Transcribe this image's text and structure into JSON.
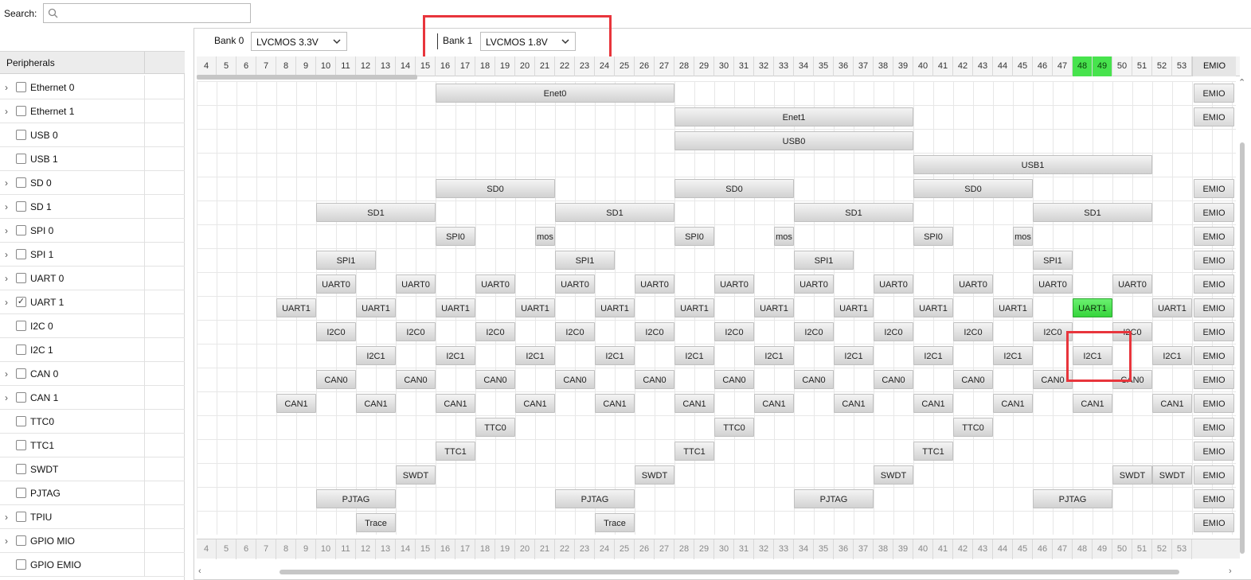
{
  "search": {
    "label": "Search:",
    "placeholder": ""
  },
  "peripherals": {
    "header": "Peripherals",
    "items": [
      {
        "label": "Ethernet 0",
        "expandable": true,
        "checked": false
      },
      {
        "label": "Ethernet 1",
        "expandable": true,
        "checked": false
      },
      {
        "label": "USB 0",
        "expandable": false,
        "checked": false
      },
      {
        "label": "USB 1",
        "expandable": false,
        "checked": false
      },
      {
        "label": "SD 0",
        "expandable": true,
        "checked": false
      },
      {
        "label": "SD 1",
        "expandable": true,
        "checked": false
      },
      {
        "label": "SPI 0",
        "expandable": true,
        "checked": false
      },
      {
        "label": "SPI 1",
        "expandable": true,
        "checked": false
      },
      {
        "label": "UART 0",
        "expandable": true,
        "checked": false
      },
      {
        "label": "UART 1",
        "expandable": true,
        "checked": true
      },
      {
        "label": "I2C 0",
        "expandable": false,
        "checked": false
      },
      {
        "label": "I2C 1",
        "expandable": false,
        "checked": false
      },
      {
        "label": "CAN 0",
        "expandable": true,
        "checked": false
      },
      {
        "label": "CAN 1",
        "expandable": true,
        "checked": false
      },
      {
        "label": "TTC0",
        "expandable": false,
        "checked": false
      },
      {
        "label": "TTC1",
        "expandable": false,
        "checked": false
      },
      {
        "label": "SWDT",
        "expandable": false,
        "checked": false
      },
      {
        "label": "PJTAG",
        "expandable": false,
        "checked": false
      },
      {
        "label": "TPIU",
        "expandable": true,
        "checked": false
      },
      {
        "label": "GPIO MIO",
        "expandable": true,
        "checked": false
      },
      {
        "label": "GPIO EMIO",
        "expandable": false,
        "checked": false
      }
    ]
  },
  "banks": {
    "bank0": {
      "label": "Bank 0",
      "value": "LVCMOS 3.3V"
    },
    "bank1": {
      "label": "Bank 1",
      "value": "LVCMOS 1.8V"
    }
  },
  "pins": {
    "numbers": [
      "4",
      "5",
      "6",
      "7",
      "8",
      "9",
      "10",
      "11",
      "12",
      "13",
      "14",
      "15",
      "16",
      "17",
      "18",
      "19",
      "20",
      "21",
      "22",
      "23",
      "24",
      "25",
      "26",
      "27",
      "28",
      "29",
      "30",
      "31",
      "32",
      "33",
      "34",
      "35",
      "36",
      "37",
      "38",
      "39",
      "40",
      "41",
      "42",
      "43",
      "44",
      "45",
      "46",
      "47",
      "48",
      "49",
      "50",
      "51",
      "52",
      "53"
    ],
    "active": [
      "48",
      "49"
    ],
    "emio_label": "EMIO"
  },
  "grid_rows": [
    {
      "emio": "EMIO",
      "blocks": [
        {
          "label": "Enet0",
          "from": "16",
          "to": "27"
        }
      ]
    },
    {
      "emio": "EMIO",
      "blocks": [
        {
          "label": "Enet1",
          "from": "28",
          "to": "39"
        }
      ]
    },
    {
      "emio": "",
      "blocks": [
        {
          "label": "USB0",
          "from": "28",
          "to": "39"
        }
      ]
    },
    {
      "emio": "",
      "blocks": [
        {
          "label": "USB1",
          "from": "40",
          "to": "51"
        }
      ]
    },
    {
      "emio": "EMIO",
      "blocks": [
        {
          "label": "SD0",
          "from": "16",
          "to": "21"
        },
        {
          "label": "SD0",
          "from": "28",
          "to": "33"
        },
        {
          "label": "SD0",
          "from": "40",
          "to": "45"
        }
      ]
    },
    {
      "emio": "EMIO",
      "blocks": [
        {
          "label": "SD1",
          "from": "10",
          "to": "15"
        },
        {
          "label": "SD1",
          "from": "22",
          "to": "27"
        },
        {
          "label": "SD1",
          "from": "34",
          "to": "39"
        },
        {
          "label": "SD1",
          "from": "46",
          "to": "51"
        }
      ]
    },
    {
      "emio": "EMIO",
      "blocks": [
        {
          "label": "SPI0",
          "from": "16",
          "to": "17"
        },
        {
          "label": "mos",
          "from": "21",
          "to": "21"
        },
        {
          "label": "SPI0",
          "from": "28",
          "to": "29"
        },
        {
          "label": "mos",
          "from": "33",
          "to": "33"
        },
        {
          "label": "SPI0",
          "from": "40",
          "to": "41"
        },
        {
          "label": "mos",
          "from": "45",
          "to": "45"
        }
      ]
    },
    {
      "emio": "EMIO",
      "blocks": [
        {
          "label": "SPI1",
          "from": "10",
          "to": "12"
        },
        {
          "label": "SPI1",
          "from": "22",
          "to": "24"
        },
        {
          "label": "SPI1",
          "from": "34",
          "to": "36"
        },
        {
          "label": "SPI1",
          "from": "46",
          "to": "47"
        }
      ]
    },
    {
      "emio": "EMIO",
      "blocks": [
        {
          "label": "UART0",
          "from": "10",
          "to": "11"
        },
        {
          "label": "UART0",
          "from": "14",
          "to": "15"
        },
        {
          "label": "UART0",
          "from": "18",
          "to": "19"
        },
        {
          "label": "UART0",
          "from": "22",
          "to": "23"
        },
        {
          "label": "UART0",
          "from": "26",
          "to": "27"
        },
        {
          "label": "UART0",
          "from": "30",
          "to": "31"
        },
        {
          "label": "UART0",
          "from": "34",
          "to": "35"
        },
        {
          "label": "UART0",
          "from": "38",
          "to": "39"
        },
        {
          "label": "UART0",
          "from": "42",
          "to": "43"
        },
        {
          "label": "UART0",
          "from": "46",
          "to": "47"
        },
        {
          "label": "UART0",
          "from": "50",
          "to": "51"
        }
      ]
    },
    {
      "emio": "EMIO",
      "blocks": [
        {
          "label": "UART1",
          "from": "8",
          "to": "9"
        },
        {
          "label": "UART1",
          "from": "12",
          "to": "13"
        },
        {
          "label": "UART1",
          "from": "16",
          "to": "17"
        },
        {
          "label": "UART1",
          "from": "20",
          "to": "21"
        },
        {
          "label": "UART1",
          "from": "24",
          "to": "25"
        },
        {
          "label": "UART1",
          "from": "28",
          "to": "29"
        },
        {
          "label": "UART1",
          "from": "32",
          "to": "33"
        },
        {
          "label": "UART1",
          "from": "36",
          "to": "37"
        },
        {
          "label": "UART1",
          "from": "40",
          "to": "41"
        },
        {
          "label": "UART1",
          "from": "44",
          "to": "45"
        },
        {
          "label": "UART1",
          "from": "48",
          "to": "49",
          "selected": true
        },
        {
          "label": "UART1",
          "from": "52",
          "to": "53"
        }
      ]
    },
    {
      "emio": "EMIO",
      "blocks": [
        {
          "label": "I2C0",
          "from": "10",
          "to": "11"
        },
        {
          "label": "I2C0",
          "from": "14",
          "to": "15"
        },
        {
          "label": "I2C0",
          "from": "18",
          "to": "19"
        },
        {
          "label": "I2C0",
          "from": "22",
          "to": "23"
        },
        {
          "label": "I2C0",
          "from": "26",
          "to": "27"
        },
        {
          "label": "I2C0",
          "from": "30",
          "to": "31"
        },
        {
          "label": "I2C0",
          "from": "34",
          "to": "35"
        },
        {
          "label": "I2C0",
          "from": "38",
          "to": "39"
        },
        {
          "label": "I2C0",
          "from": "42",
          "to": "43"
        },
        {
          "label": "I2C0",
          "from": "46",
          "to": "47"
        },
        {
          "label": "I2C0",
          "from": "50",
          "to": "51"
        }
      ]
    },
    {
      "emio": "EMIO",
      "blocks": [
        {
          "label": "I2C1",
          "from": "12",
          "to": "13"
        },
        {
          "label": "I2C1",
          "from": "16",
          "to": "17"
        },
        {
          "label": "I2C1",
          "from": "20",
          "to": "21"
        },
        {
          "label": "I2C1",
          "from": "24",
          "to": "25"
        },
        {
          "label": "I2C1",
          "from": "28",
          "to": "29"
        },
        {
          "label": "I2C1",
          "from": "32",
          "to": "33"
        },
        {
          "label": "I2C1",
          "from": "36",
          "to": "37"
        },
        {
          "label": "I2C1",
          "from": "40",
          "to": "41"
        },
        {
          "label": "I2C1",
          "from": "44",
          "to": "45"
        },
        {
          "label": "I2C1",
          "from": "48",
          "to": "49"
        },
        {
          "label": "I2C1",
          "from": "52",
          "to": "53"
        }
      ]
    },
    {
      "emio": "EMIO",
      "blocks": [
        {
          "label": "CAN0",
          "from": "10",
          "to": "11"
        },
        {
          "label": "CAN0",
          "from": "14",
          "to": "15"
        },
        {
          "label": "CAN0",
          "from": "18",
          "to": "19"
        },
        {
          "label": "CAN0",
          "from": "22",
          "to": "23"
        },
        {
          "label": "CAN0",
          "from": "26",
          "to": "27"
        },
        {
          "label": "CAN0",
          "from": "30",
          "to": "31"
        },
        {
          "label": "CAN0",
          "from": "34",
          "to": "35"
        },
        {
          "label": "CAN0",
          "from": "38",
          "to": "39"
        },
        {
          "label": "CAN0",
          "from": "42",
          "to": "43"
        },
        {
          "label": "CAN0",
          "from": "46",
          "to": "47"
        },
        {
          "label": "CAN0",
          "from": "50",
          "to": "51"
        }
      ]
    },
    {
      "emio": "EMIO",
      "blocks": [
        {
          "label": "CAN1",
          "from": "8",
          "to": "9"
        },
        {
          "label": "CAN1",
          "from": "12",
          "to": "13"
        },
        {
          "label": "CAN1",
          "from": "16",
          "to": "17"
        },
        {
          "label": "CAN1",
          "from": "20",
          "to": "21"
        },
        {
          "label": "CAN1",
          "from": "24",
          "to": "25"
        },
        {
          "label": "CAN1",
          "from": "28",
          "to": "29"
        },
        {
          "label": "CAN1",
          "from": "32",
          "to": "33"
        },
        {
          "label": "CAN1",
          "from": "36",
          "to": "37"
        },
        {
          "label": "CAN1",
          "from": "40",
          "to": "41"
        },
        {
          "label": "CAN1",
          "from": "44",
          "to": "45"
        },
        {
          "label": "CAN1",
          "from": "48",
          "to": "49"
        },
        {
          "label": "CAN1",
          "from": "52",
          "to": "53"
        }
      ]
    },
    {
      "emio": "EMIO",
      "blocks": [
        {
          "label": "TTC0",
          "from": "18",
          "to": "19"
        },
        {
          "label": "TTC0",
          "from": "30",
          "to": "31"
        },
        {
          "label": "TTC0",
          "from": "42",
          "to": "43"
        }
      ]
    },
    {
      "emio": "EMIO",
      "blocks": [
        {
          "label": "TTC1",
          "from": "16",
          "to": "17"
        },
        {
          "label": "TTC1",
          "from": "28",
          "to": "29"
        },
        {
          "label": "TTC1",
          "from": "40",
          "to": "41"
        }
      ]
    },
    {
      "emio": "EMIO",
      "blocks": [
        {
          "label": "SWDT",
          "from": "14",
          "to": "15"
        },
        {
          "label": "SWDT",
          "from": "26",
          "to": "27"
        },
        {
          "label": "SWDT",
          "from": "38",
          "to": "39"
        },
        {
          "label": "SWDT",
          "from": "50",
          "to": "51"
        },
        {
          "label": "SWDT",
          "from": "52",
          "to": "53"
        }
      ]
    },
    {
      "emio": "EMIO",
      "blocks": [
        {
          "label": "PJTAG",
          "from": "10",
          "to": "13"
        },
        {
          "label": "PJTAG",
          "from": "22",
          "to": "25"
        },
        {
          "label": "PJTAG",
          "from": "34",
          "to": "37"
        },
        {
          "label": "PJTAG",
          "from": "46",
          "to": "49"
        }
      ]
    },
    {
      "emio": "EMIO",
      "blocks": [
        {
          "label": "Trace",
          "from": "12",
          "to": "13"
        },
        {
          "label": "Trace",
          "from": "24",
          "to": "25"
        }
      ]
    }
  ]
}
